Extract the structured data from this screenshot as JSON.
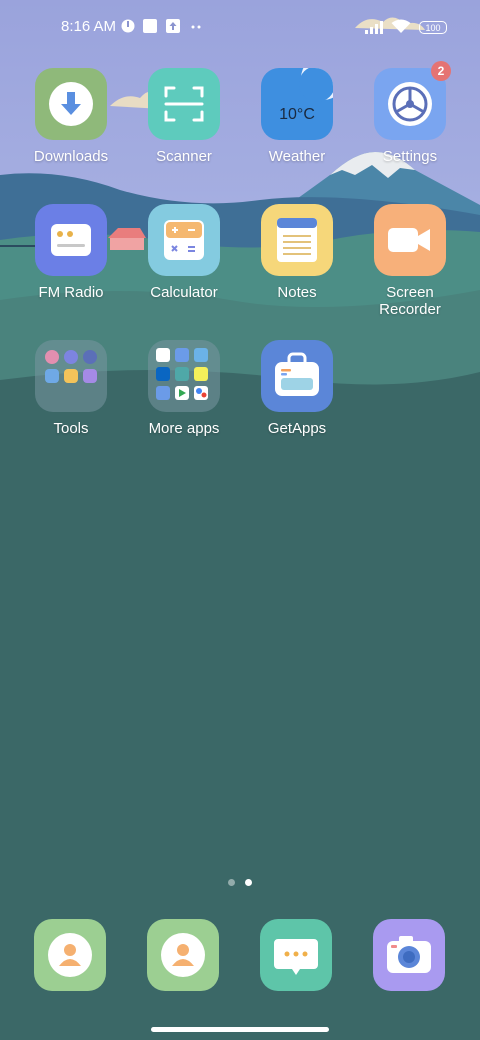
{
  "status_bar": {
    "time": "8:16 AM",
    "battery": "100",
    "icons": [
      "mi-icon",
      "square-notification-icon",
      "upload-notification-icon",
      "more-dots-icon",
      "signal-icon",
      "wifi-icon",
      "battery-icon"
    ]
  },
  "apps": [
    {
      "name": "downloads",
      "label": "Downloads",
      "color": "#8fb97a"
    },
    {
      "name": "scanner",
      "label": "Scanner",
      "color": "#5ecbbd"
    },
    {
      "name": "weather",
      "label": "Weather",
      "color": "#3e8fe0",
      "temp": "10°C"
    },
    {
      "name": "settings",
      "label": "Settings",
      "color": "#7aa5f0",
      "badge": "2"
    },
    {
      "name": "fm-radio",
      "label": "FM Radio",
      "color": "#6b7fe6"
    },
    {
      "name": "calculator",
      "label": "Calculator",
      "color": "#84cbe0"
    },
    {
      "name": "notes",
      "label": "Notes",
      "color": "#f6d77a"
    },
    {
      "name": "screen-recorder",
      "label": "Screen\nRecorder",
      "label_line1": "Screen",
      "label_line2": "Recorder",
      "color": "#f7b07a"
    },
    {
      "name": "tools",
      "label": "Tools"
    },
    {
      "name": "more-apps",
      "label": "More apps"
    },
    {
      "name": "getapps",
      "label": "GetApps",
      "color": "#5b86d8"
    }
  ],
  "dock": [
    {
      "name": "phone-contacts",
      "icon": "person-icon",
      "color": "#9ccf92"
    },
    {
      "name": "contacts",
      "icon": "person-icon",
      "color": "#9ccf92"
    },
    {
      "name": "messaging",
      "icon": "chat-bubble-icon",
      "color": "#5ec5a9"
    },
    {
      "name": "camera",
      "icon": "camera-icon",
      "color": "#a99af0"
    }
  ],
  "pages": {
    "count": 2,
    "active": 2
  }
}
